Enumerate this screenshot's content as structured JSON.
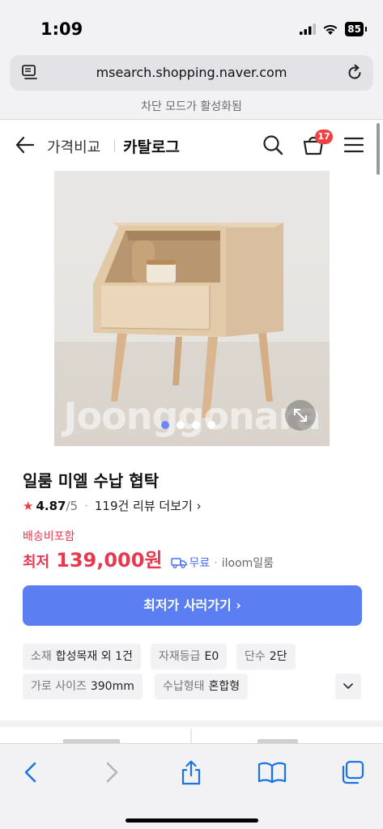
{
  "status_bar": {
    "time": "1:09",
    "battery": "85"
  },
  "browser": {
    "url": "msearch.shopping.naver.com",
    "blocked_notice": "차단 모드가 활성화됨"
  },
  "header": {
    "crumb": "가격비교",
    "title": "카탈로그",
    "cart_count": "17"
  },
  "gallery": {
    "watermark": "Joonggonara",
    "slide_count": 4,
    "active_slide": 1
  },
  "product": {
    "name": "일룸 미엘 수납 협탁",
    "rating": "4.87",
    "rating_max": "/5",
    "rating_bullet": "·",
    "review_link": "119건 리뷰 더보기 ›",
    "shipping_note": "배송비포함",
    "price_label": "최저",
    "price": "139,000원",
    "ship_free": "무료",
    "seller_bullet": "·",
    "seller": "iloom일룸",
    "buy_button": "최저가 사러가기 ›"
  },
  "specs": [
    {
      "key": "소재",
      "value": "합성목재 외 1건"
    },
    {
      "key": "자재등급",
      "value": "E0"
    },
    {
      "key": "단수",
      "value": "2단"
    },
    {
      "key": "가로 사이즈",
      "value": "390mm"
    },
    {
      "key": "수납형태",
      "value": "혼합형"
    }
  ],
  "colors": {
    "accent": "#5b7ef3",
    "price_red": "#e8384f",
    "ios_blue": "#1a73e8"
  },
  "icons": [
    "reader-icon",
    "reload-icon",
    "back-arrow-icon",
    "search-icon",
    "cart-icon",
    "menu-icon",
    "star-icon",
    "expand-icon",
    "truck-icon",
    "chevron-down-icon",
    "back-icon",
    "forward-icon",
    "share-icon",
    "bookmarks-icon",
    "tabs-icon"
  ]
}
